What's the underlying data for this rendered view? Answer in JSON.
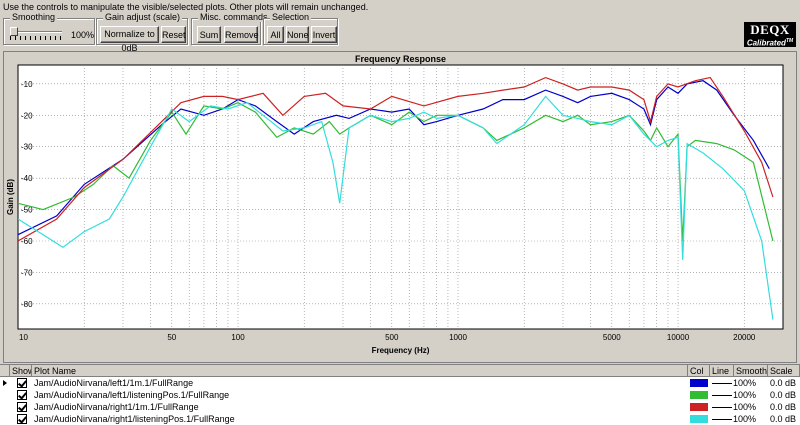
{
  "instructions": "Use the controls to manipulate the visible/selected plots.  Other plots will remain unchanged.",
  "smoothing": {
    "title": "Smoothing",
    "value": "100%"
  },
  "gain_adjust": {
    "title": "Gain adjust (scale)",
    "normalize_label": "Normalize to 0dB",
    "reset_label": "Reset"
  },
  "misc": {
    "title": "Misc. commands",
    "sum_label": "Sum",
    "remove_label": "Remove"
  },
  "selection": {
    "title": "Selection",
    "all_label": "All",
    "none_label": "None",
    "invert_label": "Invert"
  },
  "logo": {
    "main": "DEQX",
    "sub": "Calibrated",
    "tm": "TM"
  },
  "chart_data": {
    "type": "line",
    "title": "Frequency Response",
    "xlabel": "Frequency (Hz)",
    "ylabel": "Gain (dB)",
    "x_scale": "log",
    "xlim": [
      10,
      30000
    ],
    "ylim": [
      -88,
      -4
    ],
    "x_ticks": [
      10,
      50,
      100,
      500,
      1000,
      5000,
      10000,
      20000
    ],
    "x_tick_labels": [
      "10",
      "50",
      "100",
      "500",
      "1000",
      "5000",
      "10000",
      "20000"
    ],
    "y_ticks": [
      -10,
      -20,
      -30,
      -40,
      -50,
      -60,
      -70,
      -80
    ],
    "y_tick_labels": [
      "-10",
      "-20",
      "-30",
      "-40",
      "-50",
      "-60",
      "-70",
      "-80"
    ],
    "grid": true,
    "series": [
      {
        "name": "Jam/AudioNirvana/left1/1m.1/FullRange",
        "color": "#0000cc",
        "points": [
          [
            10,
            -58
          ],
          [
            15,
            -52
          ],
          [
            20,
            -42
          ],
          [
            30,
            -34
          ],
          [
            45,
            -23
          ],
          [
            55,
            -18
          ],
          [
            70,
            -20
          ],
          [
            85,
            -18
          ],
          [
            100,
            -15
          ],
          [
            120,
            -17
          ],
          [
            150,
            -22
          ],
          [
            180,
            -26
          ],
          [
            220,
            -22
          ],
          [
            280,
            -20
          ],
          [
            320,
            -21
          ],
          [
            400,
            -18
          ],
          [
            500,
            -19
          ],
          [
            600,
            -18
          ],
          [
            700,
            -23
          ],
          [
            800,
            -22
          ],
          [
            1000,
            -20
          ],
          [
            1300,
            -18
          ],
          [
            1600,
            -15
          ],
          [
            2000,
            -15
          ],
          [
            2500,
            -12
          ],
          [
            3000,
            -14
          ],
          [
            3500,
            -16
          ],
          [
            4000,
            -14
          ],
          [
            5000,
            -13
          ],
          [
            6000,
            -15
          ],
          [
            7000,
            -18
          ],
          [
            7500,
            -23
          ],
          [
            8000,
            -15
          ],
          [
            9000,
            -11
          ],
          [
            10000,
            -13
          ],
          [
            11000,
            -10
          ],
          [
            13000,
            -9
          ],
          [
            15000,
            -12
          ],
          [
            18000,
            -20
          ],
          [
            22000,
            -28
          ],
          [
            26000,
            -37
          ]
        ]
      },
      {
        "name": "Jam/AudioNirvana/left1/listeningPos.1/FullRange",
        "color": "#33bb33",
        "points": [
          [
            10,
            -48
          ],
          [
            13,
            -50
          ],
          [
            18,
            -46
          ],
          [
            22,
            -42
          ],
          [
            27,
            -36
          ],
          [
            32,
            -40
          ],
          [
            40,
            -28
          ],
          [
            50,
            -19
          ],
          [
            58,
            -26
          ],
          [
            70,
            -17
          ],
          [
            85,
            -18
          ],
          [
            100,
            -16
          ],
          [
            120,
            -19
          ],
          [
            150,
            -27
          ],
          [
            180,
            -24
          ],
          [
            220,
            -26
          ],
          [
            260,
            -22
          ],
          [
            290,
            -26
          ],
          [
            320,
            -24
          ],
          [
            400,
            -20
          ],
          [
            500,
            -23
          ],
          [
            600,
            -19
          ],
          [
            700,
            -22
          ],
          [
            800,
            -20
          ],
          [
            1000,
            -20
          ],
          [
            1300,
            -24
          ],
          [
            1500,
            -28
          ],
          [
            2000,
            -24
          ],
          [
            2500,
            -20
          ],
          [
            3000,
            -22
          ],
          [
            3500,
            -20
          ],
          [
            4000,
            -23
          ],
          [
            5000,
            -22
          ],
          [
            6000,
            -20
          ],
          [
            7000,
            -25
          ],
          [
            7500,
            -28
          ],
          [
            8000,
            -24
          ],
          [
            9000,
            -30
          ],
          [
            10000,
            -26
          ],
          [
            10500,
            -60
          ],
          [
            11000,
            -30
          ],
          [
            12000,
            -28
          ],
          [
            15000,
            -29
          ],
          [
            18000,
            -31
          ],
          [
            22000,
            -35
          ],
          [
            27000,
            -60
          ]
        ]
      },
      {
        "name": "Jam/AudioNirvana/right1/1m.1/FullRange",
        "color": "#cc2222",
        "points": [
          [
            10,
            -60
          ],
          [
            15,
            -53
          ],
          [
            20,
            -43
          ],
          [
            30,
            -34
          ],
          [
            45,
            -22
          ],
          [
            55,
            -16
          ],
          [
            70,
            -14
          ],
          [
            85,
            -14
          ],
          [
            100,
            -15
          ],
          [
            130,
            -13
          ],
          [
            160,
            -20
          ],
          [
            200,
            -14
          ],
          [
            250,
            -13
          ],
          [
            300,
            -17
          ],
          [
            400,
            -18
          ],
          [
            500,
            -14
          ],
          [
            700,
            -17
          ],
          [
            1000,
            -14
          ],
          [
            1300,
            -13
          ],
          [
            1600,
            -12
          ],
          [
            2000,
            -11
          ],
          [
            2500,
            -8
          ],
          [
            3000,
            -10
          ],
          [
            3500,
            -12
          ],
          [
            4000,
            -11
          ],
          [
            5000,
            -11
          ],
          [
            6000,
            -12
          ],
          [
            7000,
            -15
          ],
          [
            7500,
            -22
          ],
          [
            8000,
            -14
          ],
          [
            9000,
            -10
          ],
          [
            10000,
            -11
          ],
          [
            12000,
            -9
          ],
          [
            14000,
            -8
          ],
          [
            16000,
            -14
          ],
          [
            20000,
            -25
          ],
          [
            24000,
            -35
          ],
          [
            27000,
            -46
          ]
        ]
      },
      {
        "name": "Jam/AudioNirvana/right1/listeningPos.1/FullRange",
        "color": "#33dddd",
        "points": [
          [
            10,
            -53
          ],
          [
            13,
            -58
          ],
          [
            16,
            -62
          ],
          [
            20,
            -57
          ],
          [
            26,
            -53
          ],
          [
            30,
            -46
          ],
          [
            40,
            -30
          ],
          [
            50,
            -18
          ],
          [
            60,
            -22
          ],
          [
            75,
            -17
          ],
          [
            90,
            -18
          ],
          [
            110,
            -16
          ],
          [
            130,
            -20
          ],
          [
            160,
            -25
          ],
          [
            200,
            -24
          ],
          [
            240,
            -22
          ],
          [
            270,
            -35
          ],
          [
            290,
            -48
          ],
          [
            320,
            -24
          ],
          [
            400,
            -20
          ],
          [
            500,
            -22
          ],
          [
            600,
            -21
          ],
          [
            700,
            -19
          ],
          [
            800,
            -21
          ],
          [
            1000,
            -20
          ],
          [
            1300,
            -24
          ],
          [
            1500,
            -29
          ],
          [
            2000,
            -23
          ],
          [
            2500,
            -14
          ],
          [
            3000,
            -20
          ],
          [
            3500,
            -21
          ],
          [
            4000,
            -22
          ],
          [
            5000,
            -23
          ],
          [
            6000,
            -20
          ],
          [
            7000,
            -26
          ],
          [
            8000,
            -30
          ],
          [
            9000,
            -28
          ],
          [
            10000,
            -27
          ],
          [
            10500,
            -66
          ],
          [
            11000,
            -29
          ],
          [
            13000,
            -32
          ],
          [
            16000,
            -37
          ],
          [
            20000,
            -44
          ],
          [
            24000,
            -60
          ],
          [
            27000,
            -85
          ]
        ]
      }
    ]
  },
  "table": {
    "headers": {
      "show": "Show",
      "name": "Plot Name",
      "col": "Col",
      "line": "Line",
      "smooth": "Smooth",
      "scale": "Scale"
    },
    "rows": [
      {
        "name": "Jam/AudioNirvana/left1/1m.1/FullRange",
        "color": "#0000cc",
        "smooth": "100%",
        "scale": "0.0 dB"
      },
      {
        "name": "Jam/AudioNirvana/left1/listeningPos.1/FullRange",
        "color": "#33bb33",
        "smooth": "100%",
        "scale": "0.0 dB"
      },
      {
        "name": "Jam/AudioNirvana/right1/1m.1/FullRange",
        "color": "#cc2222",
        "smooth": "100%",
        "scale": "0.0 dB"
      },
      {
        "name": "Jam/AudioNirvana/right1/listeningPos.1/FullRange",
        "color": "#33dddd",
        "smooth": "100%",
        "scale": "0.0 dB"
      }
    ]
  }
}
